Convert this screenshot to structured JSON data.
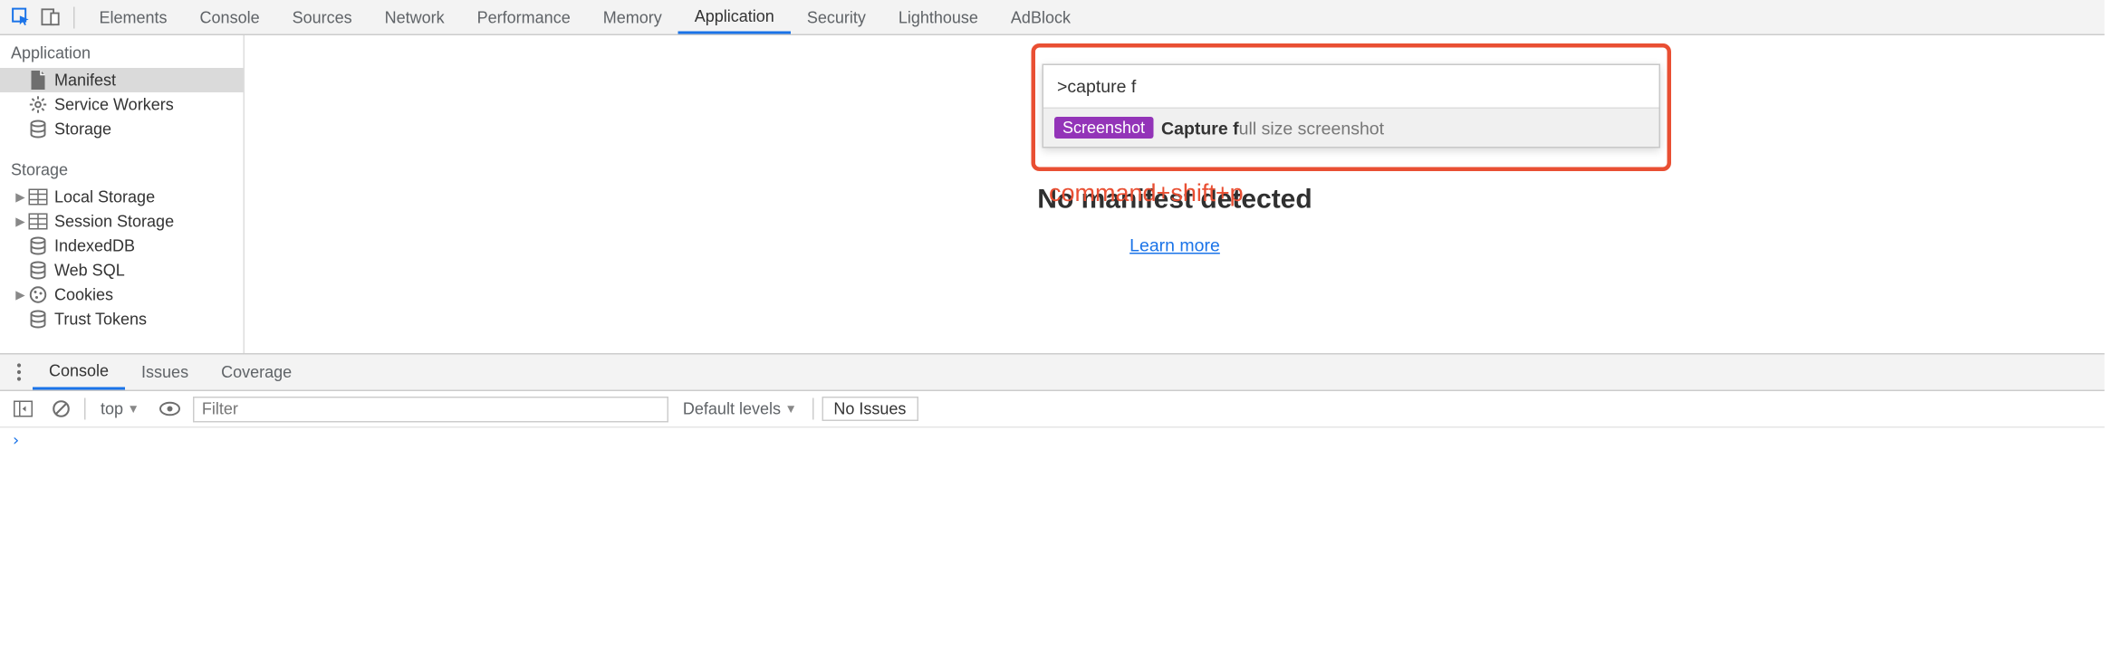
{
  "top_tabs": {
    "elements": "Elements",
    "console": "Console",
    "sources": "Sources",
    "network": "Network",
    "performance": "Performance",
    "memory": "Memory",
    "application": "Application",
    "security": "Security",
    "lighthouse": "Lighthouse",
    "adblock": "AdBlock"
  },
  "sidebar": {
    "section_application": "Application",
    "manifest": "Manifest",
    "service_workers": "Service Workers",
    "storage_item": "Storage",
    "section_storage": "Storage",
    "local_storage": "Local Storage",
    "session_storage": "Session Storage",
    "indexeddb": "IndexedDB",
    "web_sql": "Web SQL",
    "cookies": "Cookies",
    "trust_tokens": "Trust Tokens"
  },
  "content": {
    "no_manifest": "No manifest detected",
    "learn_more": "Learn more"
  },
  "command_menu": {
    "input_prefix": ">",
    "input_value": "capture f",
    "badge": "Screenshot",
    "result_bold": "Capture f",
    "result_rest": "ull size screenshot"
  },
  "annotation": {
    "shortcut": "command+shift+p"
  },
  "drawer": {
    "tabs": {
      "console": "Console",
      "issues": "Issues",
      "coverage": "Coverage"
    },
    "context": "top",
    "filter_placeholder": "Filter",
    "levels": "Default levels",
    "no_issues": "No Issues"
  }
}
